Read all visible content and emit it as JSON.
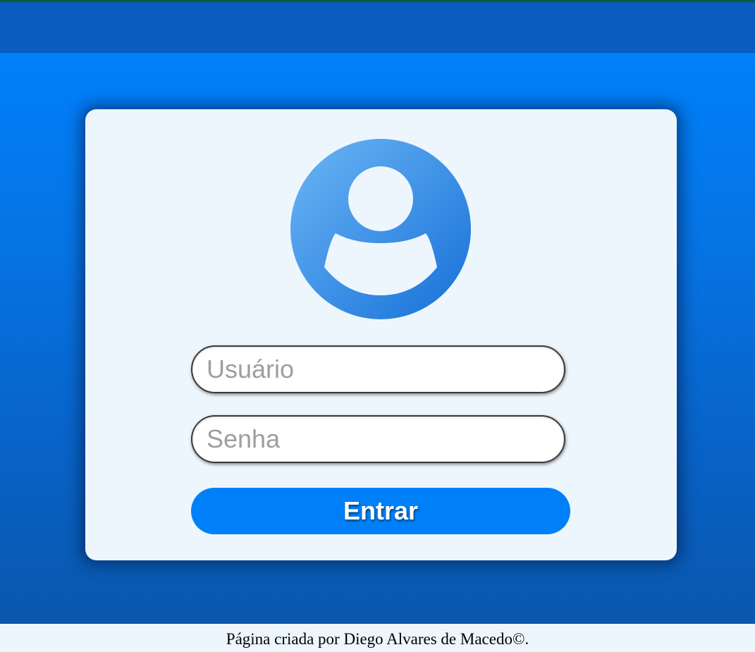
{
  "colors": {
    "header": "#0a5cbf",
    "accent": "#0080f8",
    "card": "#eef6fd",
    "top_line": "#0e5b3c"
  },
  "login": {
    "avatar_icon": "user-profile-icon",
    "username_placeholder": "Usuário",
    "password_placeholder": "Senha",
    "submit_label": "Entrar"
  },
  "footer": {
    "text": "Página criada por Diego Alvares de Macedo©."
  }
}
